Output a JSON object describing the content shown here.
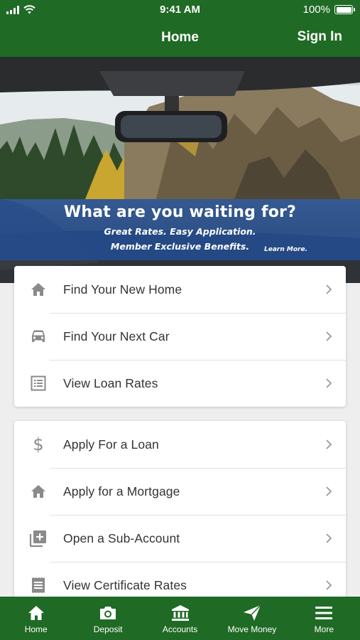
{
  "status_bar": {
    "time": "9:41 AM",
    "battery": "100%"
  },
  "header": {
    "title": "Home",
    "sign_in": "Sign In"
  },
  "banner": {
    "headline": "What are you waiting for?",
    "line1": "Great Rates. Easy Application.",
    "line2": "Member Exclusive Benefits.",
    "learn_more": "Learn More."
  },
  "card1": {
    "items": [
      {
        "label": "Find Your New Home",
        "icon": "home-icon"
      },
      {
        "label": "Find Your Next Car",
        "icon": "car-icon"
      },
      {
        "label": "View Loan Rates",
        "icon": "list-icon"
      }
    ]
  },
  "card2": {
    "items": [
      {
        "label": "Apply For a Loan",
        "icon": "dollar-icon"
      },
      {
        "label": "Apply for a Mortgage",
        "icon": "home-icon"
      },
      {
        "label": "Open a Sub-Account",
        "icon": "add-box-icon"
      },
      {
        "label": "View Certificate Rates",
        "icon": "certificate-icon"
      }
    ]
  },
  "tabs": [
    {
      "label": "Home",
      "icon": "home-icon"
    },
    {
      "label": "Deposit",
      "icon": "camera-icon"
    },
    {
      "label": "Accounts",
      "icon": "bank-icon"
    },
    {
      "label": "Move Money",
      "icon": "paper-plane-icon"
    },
    {
      "label": "More",
      "icon": "menu-icon"
    }
  ],
  "colors": {
    "brand_green": "#1f6a25",
    "banner_blue": "#224e96",
    "icon_gray": "#8a8a8a",
    "text": "#333333"
  }
}
